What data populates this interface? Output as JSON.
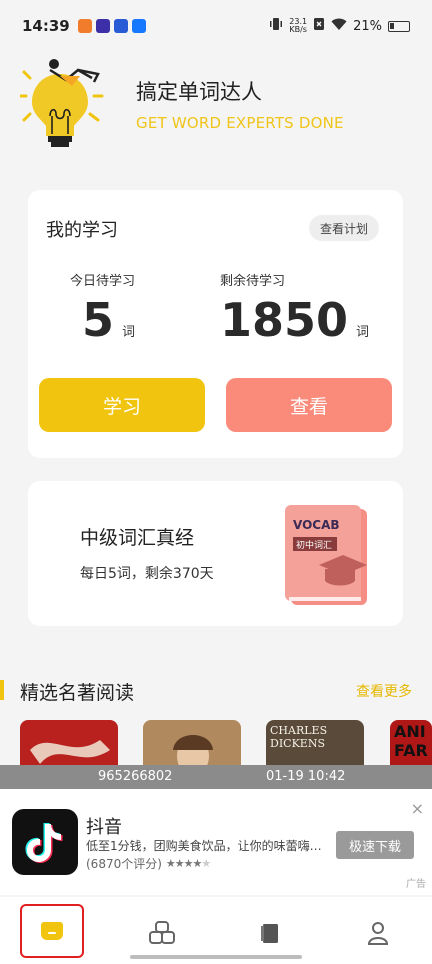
{
  "status_bar": {
    "time": "14:39",
    "app_icons": [
      "orange-app-icon",
      "purple-play-icon",
      "blue-link-icon",
      "alipay-icon"
    ],
    "net_speed_value": "23.1",
    "net_speed_unit": "KB/s",
    "battery": "21%"
  },
  "header": {
    "title": "搞定单词达人",
    "subtitle": "GET WORD EXPERTS DONE"
  },
  "study_card": {
    "title": "我的学习",
    "plan_button": "查看计划",
    "today_label": "今日待学习",
    "today_value": "5",
    "today_unit": "词",
    "remaining_label": "剩余待学习",
    "remaining_value": "1850",
    "remaining_unit": "词",
    "study_button": "学习",
    "view_button": "查看"
  },
  "book_card": {
    "title": "中级词汇真经",
    "subtitle": "每日5词，剩余370天",
    "cover_title": "VOCAB",
    "cover_tag": "初中词汇"
  },
  "reading": {
    "title": "精选名著阅读",
    "more": "查看更多",
    "thumbs": [
      "",
      "",
      "CHARLES DICKENS",
      "ANI FAR"
    ]
  },
  "overlay": {
    "id": "965266802",
    "timestamp": "01-19 10:42"
  },
  "ad": {
    "app_name": "抖音",
    "description": "低至1分钱，团购美食饮品，让你的味蕾嗨…",
    "rating_text": "(6870个评分)",
    "rating": 4,
    "download_button": "极速下载",
    "close": "×",
    "label": "广告"
  },
  "nav": {
    "items": [
      "home-icon",
      "apps-icon",
      "book-icon",
      "profile-icon"
    ]
  },
  "colors": {
    "accent_yellow": "#f1c40f",
    "accent_salmon": "#fa8a7a",
    "highlight_red": "#e02020"
  }
}
